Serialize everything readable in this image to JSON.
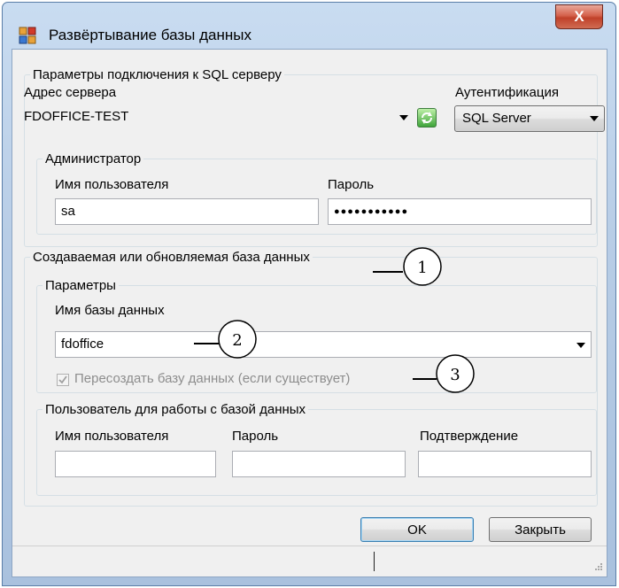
{
  "window": {
    "title": "Развёртывание базы данных",
    "close_label": "X"
  },
  "connection": {
    "group_title": "Параметры подключения к SQL серверу",
    "server_label": "Адрес сервера",
    "server_value": "FDOFFICE-TEST",
    "auth_label": "Аутентификация",
    "auth_value": "SQL Server",
    "admin": {
      "group_title": "Администратор",
      "username_label": "Имя пользователя",
      "username_value": "sa",
      "password_label": "Пароль",
      "password_value": "●●●●●●●●●●●"
    }
  },
  "database": {
    "group_title": "Создаваемая или обновляемая база данных",
    "params": {
      "group_title": "Параметры",
      "dbname_label": "Имя базы данных",
      "dbname_value": "fdoffice",
      "recreate_label": "Пересоздать базу данных (если существует)",
      "recreate_checked": true
    },
    "user": {
      "group_title": "Пользователь для работы с базой данных",
      "username_label": "Имя пользователя",
      "password_label": "Пароль",
      "confirm_label": "Подтверждение",
      "username_value": "",
      "password_value": "",
      "confirm_value": ""
    }
  },
  "buttons": {
    "ok": "OK",
    "close": "Закрыть"
  },
  "callouts": [
    "1",
    "2",
    "3"
  ],
  "colors": {
    "title_bar": "#b8cde6",
    "close_button": "#c0412a",
    "client_bg": "#f0f0f0",
    "default_button_border": "#3c7fb1"
  },
  "icons": {
    "app": "database-deploy-icon",
    "refresh": "refresh-icon",
    "dropdown": "chevron-down-icon",
    "check": "check-icon",
    "grip": "resize-grip-icon"
  }
}
